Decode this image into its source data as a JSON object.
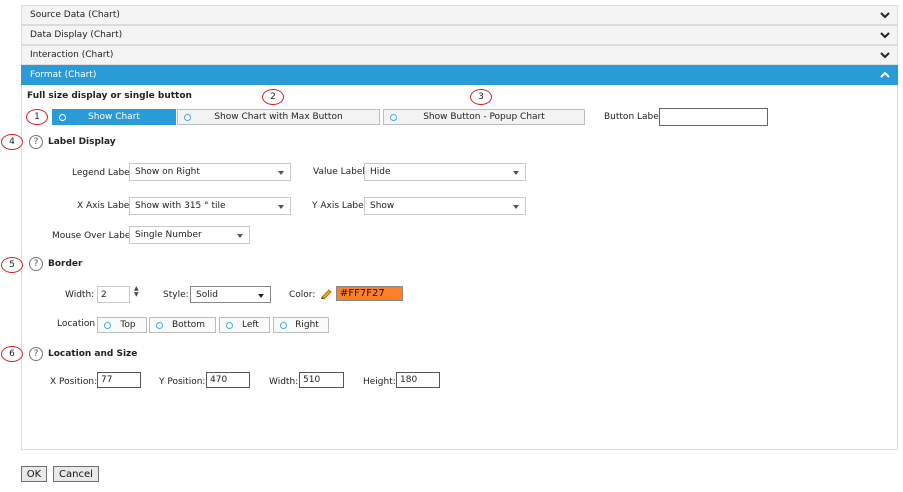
{
  "accordion": [
    {
      "label": "Source Data (Chart)",
      "expanded": false
    },
    {
      "label": "Data Display (Chart)",
      "expanded": false
    },
    {
      "label": "Interaction (Chart)",
      "expanded": false
    },
    {
      "label": "Format (Chart)",
      "expanded": true
    }
  ],
  "display_mode": {
    "heading": "Full size display or single button",
    "options": [
      "Show Chart",
      "Show Chart with Max Button",
      "Show Button - Popup Chart"
    ],
    "selected": "Show Chart",
    "button_label_caption": "Button Label",
    "button_label_value": ""
  },
  "callouts": [
    "1",
    "2",
    "3",
    "4",
    "5",
    "6"
  ],
  "label_display": {
    "title": "Label Display",
    "legend_label": {
      "caption": "Legend Label",
      "value": "Show on Right"
    },
    "value_label": {
      "caption": "Value Label",
      "value": "Hide"
    },
    "x_axis_label": {
      "caption": "X Axis Label",
      "value": "Show with 315 ° tile"
    },
    "y_axis_label": {
      "caption": "Y Axis Label",
      "value": "Show"
    },
    "mouse_over_label": {
      "caption": "Mouse Over Label",
      "value": "Single Number"
    }
  },
  "border": {
    "title": "Border",
    "width_caption": "Width:",
    "width_value": "2",
    "style_caption": "Style:",
    "style_value": "Solid",
    "color_caption": "Color:",
    "color_value": "#FF7F27",
    "location_caption": "Location",
    "locations": [
      "Top",
      "Bottom",
      "Left",
      "Right"
    ]
  },
  "location_size": {
    "title": "Location and Size",
    "x_caption": "X Position:",
    "x_value": "77",
    "y_caption": "Y Position:",
    "y_value": "470",
    "w_caption": "Width:",
    "w_value": "510",
    "h_caption": "Height:",
    "h_value": "180"
  },
  "help_glyph": "?",
  "footer": {
    "ok": "OK",
    "cancel": "Cancel"
  },
  "colors": {
    "accent": "#2b9bd8",
    "callout": "#d02020",
    "swatch": "#FF7F27"
  }
}
